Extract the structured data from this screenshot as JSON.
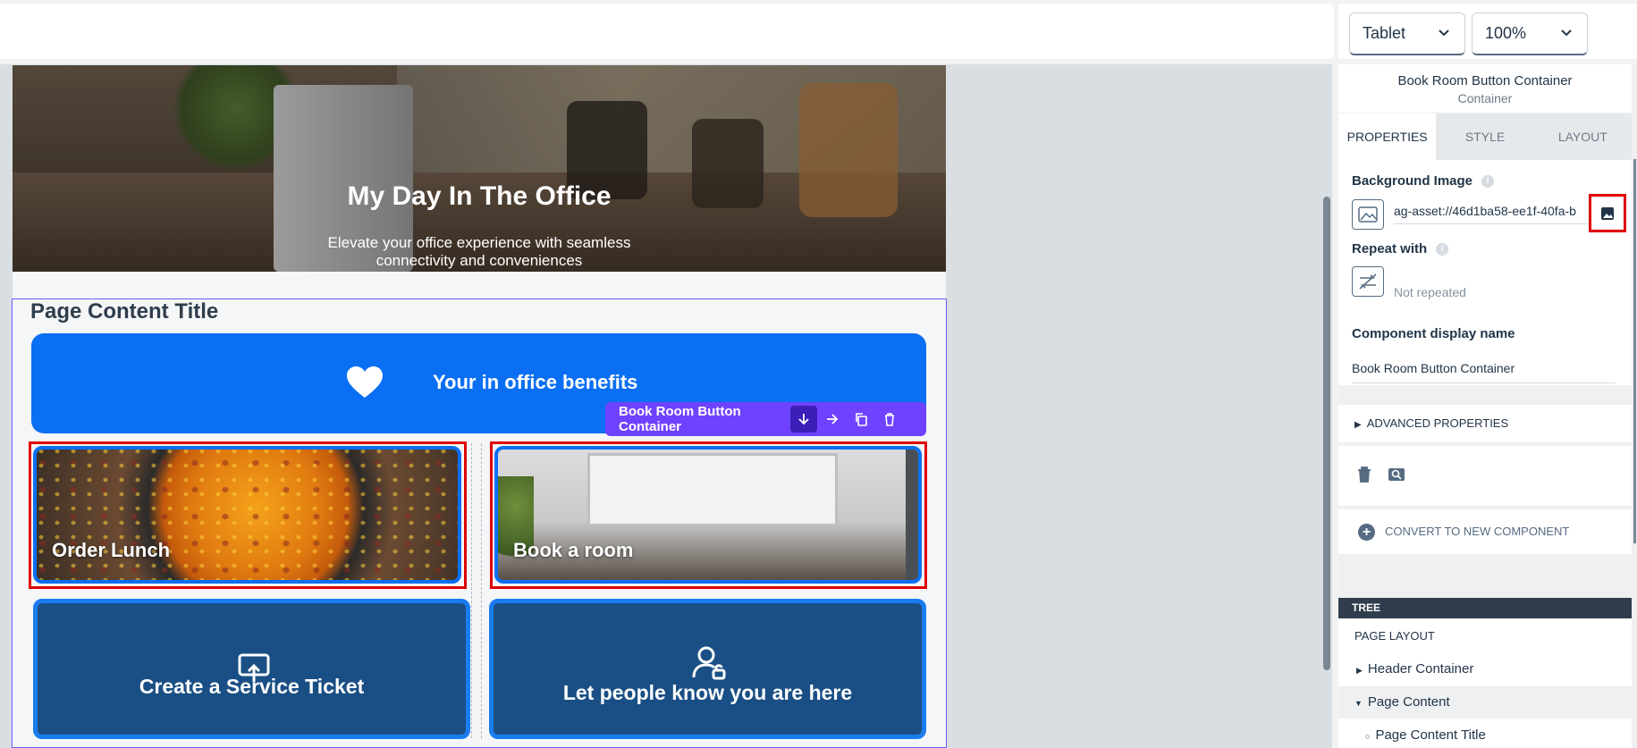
{
  "toolbar": {
    "device": "Tablet",
    "zoom": "100%"
  },
  "hero": {
    "title": "My Day In The Office",
    "subtitle": "Elevate your office experience with seamless connectivity and conveniences"
  },
  "content": {
    "title": "Page Content Title",
    "benefits_label": "Your in office benefits",
    "selection_toolbar_label": "Book Room Button Container",
    "tiles": {
      "lunch": "Order Lunch",
      "room": "Book a room",
      "ticket": "Create a Service Ticket",
      "here": "Let people know you are here"
    }
  },
  "panel": {
    "component_name": "Book Room Button Container",
    "component_type": "Container",
    "tabs": [
      "PROPERTIES",
      "STYLE",
      "LAYOUT"
    ],
    "background_image_label": "Background Image",
    "background_image_value": "ag-asset://46d1ba58-ee1f-40fa-b",
    "repeat_label": "Repeat with",
    "repeat_value": "Not repeated",
    "display_name_label": "Component display name",
    "display_name_value": "Book Room Button Container",
    "advanced_label": "ADVANCED PROPERTIES",
    "convert_label": "CONVERT TO NEW COMPONENT"
  },
  "tree": {
    "header": "TREE",
    "items": [
      "PAGE LAYOUT",
      "Header Container",
      "Page Content",
      "Page Content Title"
    ]
  },
  "colors": {
    "accent": "#0a6ff2",
    "selection": "#6f42ff",
    "highlight_red": "#e00000",
    "tile_blue": "#1a4f85"
  }
}
